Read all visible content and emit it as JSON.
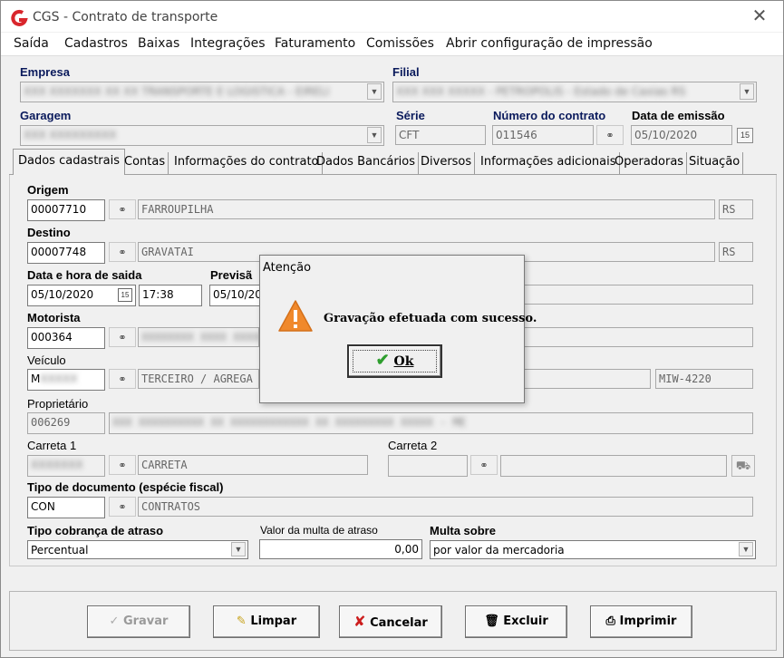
{
  "window": {
    "title": "CGS - Contrato de transporte"
  },
  "menu": [
    "Saída",
    "Cadastros",
    "Baixas",
    "Integrações",
    "Faturamento",
    "Comissões",
    "Abrir configuração de impressão"
  ],
  "header": {
    "empresa_label": "Empresa",
    "empresa_value": "XXX XXXXXXX XX XX TRANSPORTE E LOGISTICA - EIRELI",
    "filial_label": "Filial",
    "filial_value": "XXX XXX XXXXX - PETROPOLIS - Estado de Caxias RS",
    "garagem_label": "Garagem",
    "garagem_value": "XXX XXXXXXXXX",
    "serie_label": "Série",
    "serie_value": "CFT",
    "numero_label": "Número do contrato",
    "numero_value": "011546",
    "data_emissao_label": "Data de emissão",
    "data_emissao_value": "05/10/2020"
  },
  "tabs": [
    "Dados cadastrais",
    "Contas",
    "Informações do contrato",
    "Dados Bancários",
    "Diversos",
    "Informações adicionais",
    "Operadoras",
    "Situação"
  ],
  "form": {
    "origem_label": "Origem",
    "origem_code": "00007710",
    "origem_name": "FARROUPILHA",
    "origem_uf": "RS",
    "destino_label": "Destino",
    "destino_code": "00007748",
    "destino_name": "GRAVATAI",
    "destino_uf": "RS",
    "data_saida_label": "Data e hora de saida",
    "data_saida": "05/10/2020",
    "hora_saida": "17:38",
    "previsao_label": "Previsã",
    "previsao_date": "05/10/20",
    "motorista_label": "Motorista",
    "motorista_code": "000364",
    "motorista_name": "XXXXXXXX XXXX XXXXX",
    "veiculo_label": "Veículo",
    "veiculo_code": "M",
    "veiculo_type": "TERCEIRO / AGREGA",
    "veiculo_plate": "MIW-4220",
    "proprietario_label": "Proprietário",
    "proprietario_code": "006269",
    "proprietario_name": "XXX XXXXXXXXXX XX XXXXXXXXXXXX XX XXXXXXXXX XXXXX - ME",
    "carreta1_label": "Carreta 1",
    "carreta1_code": "XXXXXXX",
    "carreta1_name": "CARRETA",
    "carreta2_label": "Carreta 2",
    "tipo_doc_label": "Tipo de documento (espécie fiscal)",
    "tipo_doc_code": "CON",
    "tipo_doc_name": "CONTRATOS",
    "tipo_cobranca_label": "Tipo cobrança de atraso",
    "tipo_cobranca_value": "Percentual",
    "valor_multa_label": "Valor da multa de atraso",
    "valor_multa_value": "0,00",
    "multa_sobre_label": "Multa sobre",
    "multa_sobre_value": "por valor da mercadoria"
  },
  "buttons": {
    "gravar": "Gravar",
    "limpar": "Limpar",
    "cancelar": "Cancelar",
    "excluir": "Excluir",
    "imprimir": "Imprimir"
  },
  "dialog": {
    "title": "Atenção",
    "message": "Gravação efetuada com sucesso.",
    "ok_label": "Ok"
  },
  "colors": {
    "brand_red": "#d9262c",
    "label_blue": "#0a1a5c",
    "warning_orange": "#f0892c",
    "ok_green": "#2e9e2e"
  }
}
